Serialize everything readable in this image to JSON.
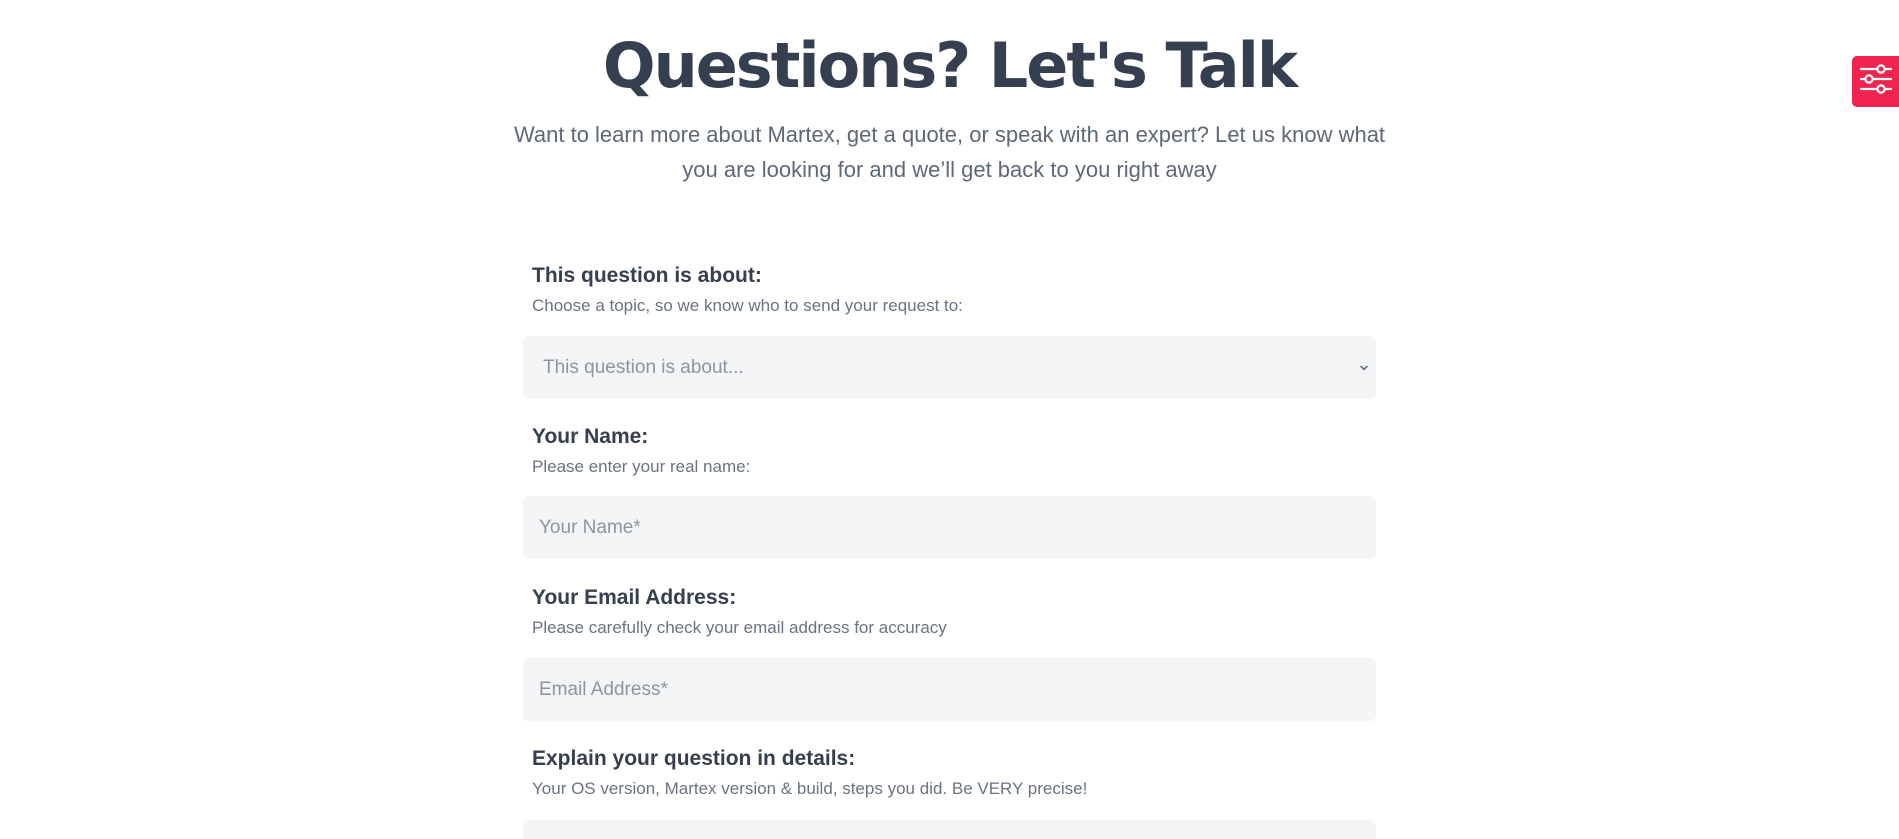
{
  "hero": {
    "title": "Questions? Let's Talk",
    "subtitle": "Want to learn more about Martex, get a quote, or speak with an expert? Let us know what you are looking for and we’ll get back to you right away"
  },
  "form": {
    "topic": {
      "label": "This question is about:",
      "hint": "Choose a topic, so we know who to send your request to:",
      "placeholder": "This question is about..."
    },
    "name": {
      "label": "Your Name:",
      "hint": "Please enter your real name:",
      "placeholder": "Your Name*"
    },
    "email": {
      "label": "Your Email Address:",
      "hint": "Please carefully check your email address for accuracy",
      "placeholder": "Email Address*"
    },
    "details": {
      "label": "Explain your question in details:",
      "hint": "Your OS version, Martex version & build, steps you did. Be VERY precise!"
    }
  },
  "settings_tab": {
    "icon": "sliders-icon",
    "color": "#f0244f"
  }
}
